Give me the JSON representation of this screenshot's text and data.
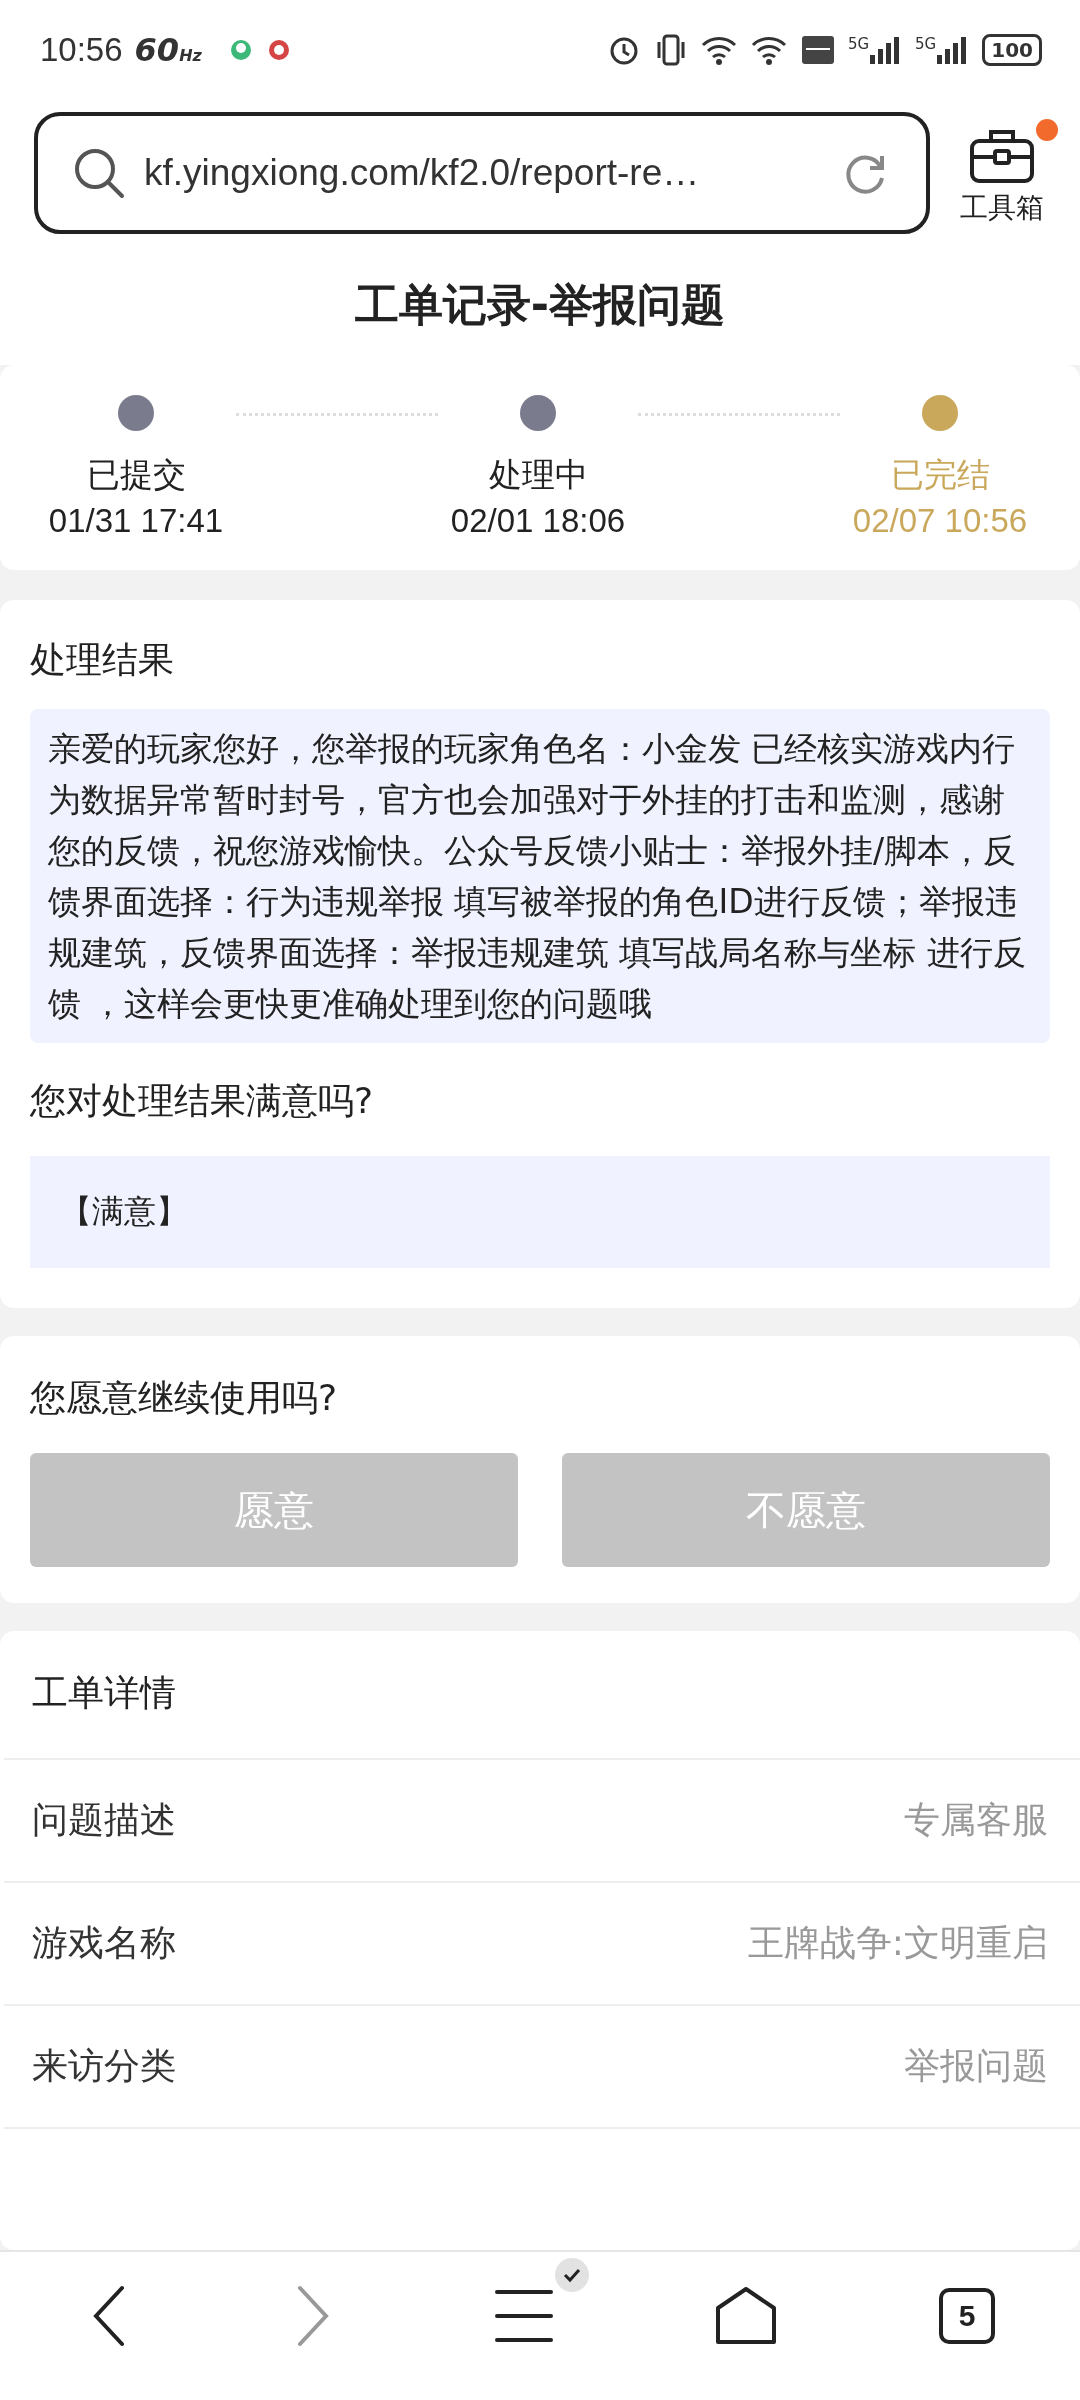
{
  "status_bar": {
    "time": "10:56",
    "refresh_rate": "60",
    "refresh_unit": "Hz",
    "network_5g_1": "5G",
    "network_5g_2": "5G",
    "battery": "100"
  },
  "browser": {
    "url": "kf.yingxiong.com/kf2.0/report-re…",
    "toolbox_label": "工具箱",
    "toolbox_badge": true
  },
  "page_title": "工单记录-举报问题",
  "steps": [
    {
      "label": "已提交",
      "time": "01/31 17:41",
      "active": false
    },
    {
      "label": "处理中",
      "time": "02/01 18:06",
      "active": false
    },
    {
      "label": "已完结",
      "time": "02/07 10:56",
      "active": true
    }
  ],
  "result": {
    "heading": "处理结果",
    "message": "亲爱的玩家您好，您举报的玩家角色名：小金发 已经核实游戏内行为数据异常暂时封号，官方也会加强对于外挂的打击和监测，感谢您的反馈，祝您游戏愉快。公众号反馈小贴士：举报外挂/脚本，反馈界面选择：行为违规举报 填写被举报的角色ID进行反馈；举报违规建筑，反馈界面选择：举报违规建筑 填写战局名称与坐标 进行反馈 ，这样会更快更准确处理到您的问题哦",
    "satisfaction_question": "您对处理结果满意吗?",
    "satisfaction_answer": "【满意】"
  },
  "continue": {
    "question": "您愿意继续使用吗?",
    "buttons": [
      {
        "label": "愿意",
        "disabled": true
      },
      {
        "label": "不愿意",
        "disabled": true
      }
    ]
  },
  "details": {
    "heading": "工单详情",
    "rows": [
      {
        "label": "问题描述",
        "value": "专属客服"
      },
      {
        "label": "游戏名称",
        "value": "王牌战争:文明重启"
      },
      {
        "label": "来访分类",
        "value": "举报问题"
      }
    ]
  },
  "bottom_nav": {
    "tabs_count": "5",
    "menu_badge": true
  }
}
